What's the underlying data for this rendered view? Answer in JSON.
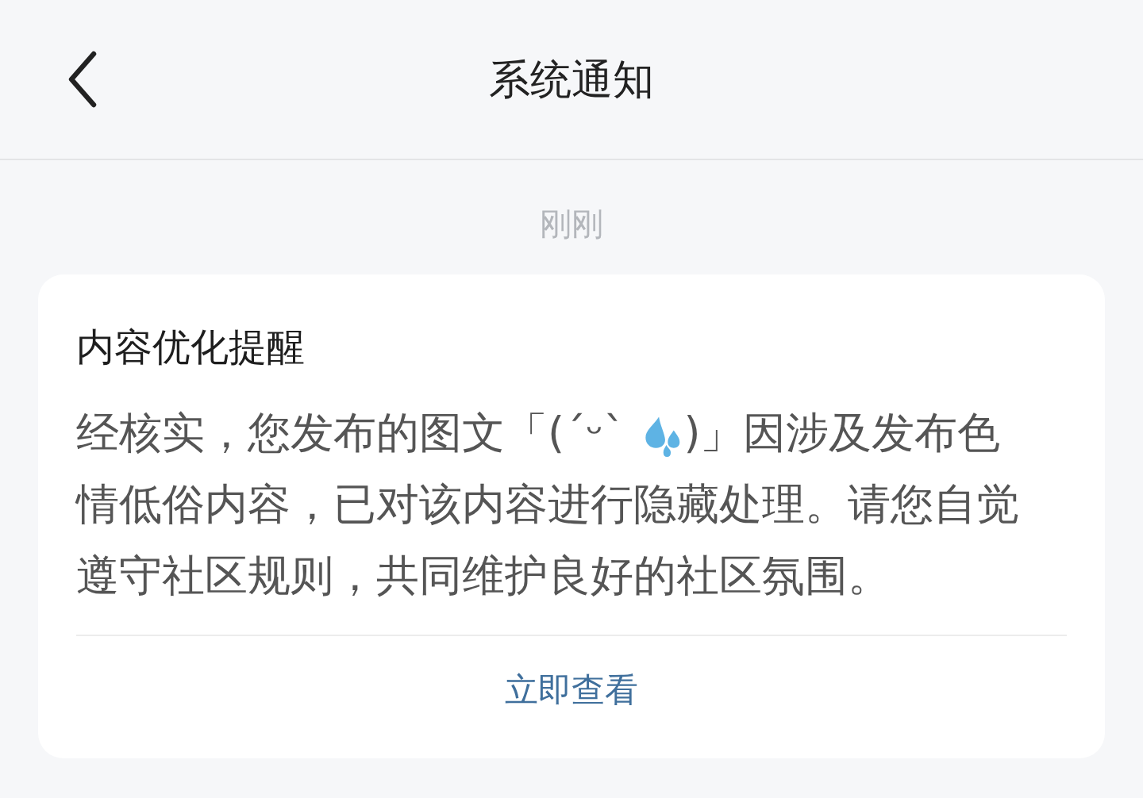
{
  "header": {
    "title": "系统通知"
  },
  "time": "刚刚",
  "card": {
    "title": "内容优化提醒",
    "body_line1_before": "经核实，您发布的图文「(´ᵕ`",
    "body_line1_after": ")」因涉及发布色",
    "body_rest": "情低俗内容，已对该内容进行隐藏处理。请您自觉遵守社区规则，共同维护良好的社区氛围。",
    "action": "立即查看"
  }
}
